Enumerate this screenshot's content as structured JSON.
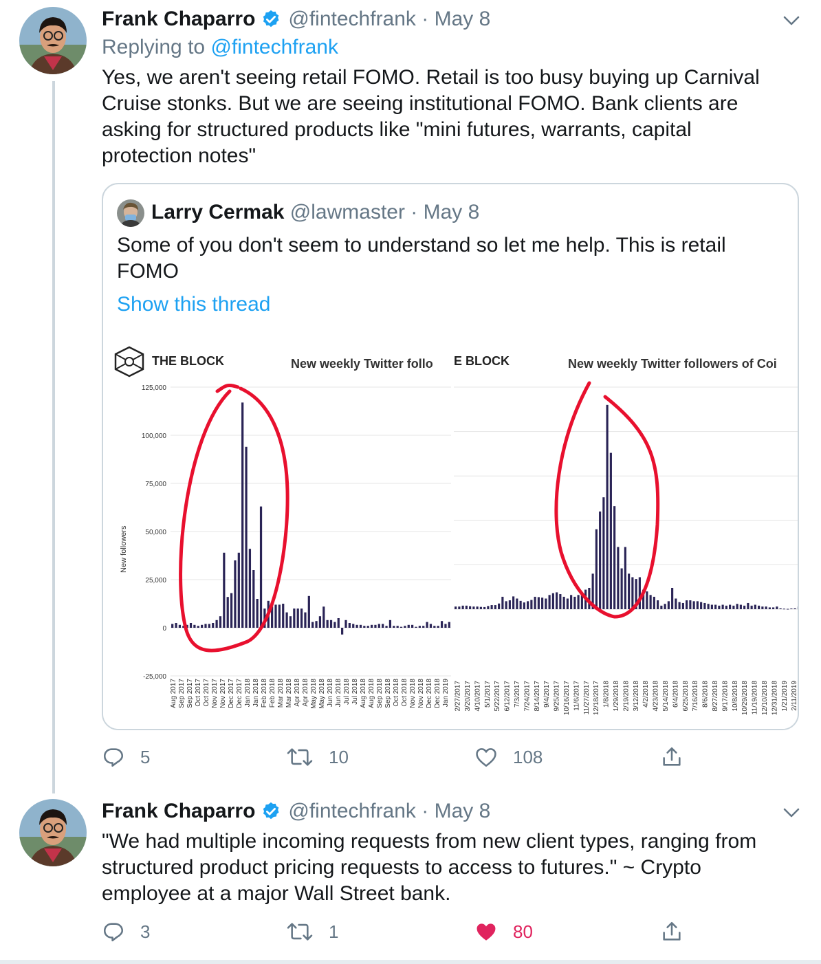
{
  "tweets": [
    {
      "author": {
        "name": "Frank Chaparro",
        "handle": "@fintechfrank",
        "verified": true
      },
      "date": "May 8",
      "replying_prefix": "Replying to ",
      "replying_to": "@fintechfrank",
      "text": "Yes, we aren't seeing retail FOMO. Retail is too busy buying up Carnival Cruise stonks. But we are seeing institutional FOMO. Bank clients are asking for structured products like \"mini futures, warrants, capital protection notes\"",
      "quote": {
        "author": {
          "name": "Larry Cermak",
          "handle": "@lawmaster"
        },
        "date": "May 8",
        "text": "Some of you don't seem to understand so let me help. This is retail FOMO",
        "show_thread": "Show this thread",
        "image": {
          "brand": "THE BLOCK",
          "brand_partial": "E BLOCK",
          "left_title": "New weekly Twitter follo",
          "right_title": "New weekly Twitter followers of Coi"
        }
      },
      "actions": {
        "replies": "5",
        "retweets": "10",
        "likes": "108",
        "liked": false
      }
    },
    {
      "author": {
        "name": "Frank Chaparro",
        "handle": "@fintechfrank",
        "verified": true
      },
      "date": "May 8",
      "text": "\"We had multiple incoming requests from new client types, ranging from structured product pricing requests to access to futures.\" ~ Crypto employee at a major Wall Street bank.",
      "actions": {
        "replies": "3",
        "retweets": "1",
        "likes": "80",
        "liked": true
      }
    }
  ],
  "separator": " · ",
  "icons": [
    "verified-badge-icon",
    "chevron-down-icon",
    "reply-icon",
    "retweet-icon",
    "like-icon",
    "share-icon",
    "the-block-logo-icon"
  ],
  "colors": {
    "accent": "#1da1f2",
    "text": "#14171a",
    "muted": "#657786",
    "like": "#e0245e",
    "bars": "#2a2456",
    "annotation": "#e8102e"
  },
  "chart_data": [
    {
      "type": "bar",
      "title": "New weekly Twitter follo",
      "ylabel": "New followers",
      "ylim": [
        -25000,
        125000
      ],
      "yticks": [
        "-25,000",
        "0",
        "25,000",
        "50,000",
        "75,000",
        "100,000",
        "125,000"
      ],
      "x_tick_labels": [
        "Aug 2017",
        "Sep 2017",
        "Sep 2017",
        "Oct 2017",
        "Oct 2017",
        "Nov 2017",
        "Nov 2017",
        "Dec 2017",
        "Dec 2017",
        "Jan 2018",
        "Jan 2018",
        "Feb 2018",
        "Feb 2018",
        "Mar 2018",
        "Mar 2018",
        "Apr 2018",
        "Apr 2018",
        "May 2018",
        "May 2018",
        "Jun 2018",
        "Jun 2018",
        "Jul 2018",
        "Jul 2018",
        "Aug 2018",
        "Aug 2018",
        "Sep 2018",
        "Sep 2018",
        "Oct 2018",
        "Oct 2018",
        "Nov 2018",
        "Nov 2018",
        "Dec 2018",
        "Dec 2018",
        "Jan 2019"
      ],
      "series": [
        {
          "values": [
            2000,
            2500,
            1500,
            1000,
            1500,
            2500,
            1500,
            1000,
            1500,
            2000,
            2000,
            2500,
            4000,
            6000,
            39000,
            16000,
            18000,
            35000,
            39000,
            117000,
            94000,
            41000,
            30000,
            15000,
            63000,
            10000,
            14000,
            11000,
            12000,
            12000,
            12500,
            8000,
            6000,
            10000,
            10000,
            10000,
            8000,
            16500,
            3000,
            3500,
            6000,
            11000,
            4000,
            4000,
            3000,
            5000,
            -3500,
            4000,
            2500,
            2000,
            1500,
            1500,
            1000,
            1000,
            1500,
            1500,
            2000,
            2000,
            1000,
            4000,
            1000,
            1000,
            500,
            1000,
            1500,
            1500,
            500,
            1000,
            1000,
            3000,
            2000,
            1000,
            1000,
            3500,
            2000,
            3000
          ]
        }
      ]
    },
    {
      "type": "bar",
      "title": "New weekly Twitter followers of Coi",
      "ylabel": "",
      "x_tick_labels": [
        "2/27/2017",
        "3/20/2017",
        "4/10/2017",
        "5/1/2017",
        "5/22/2017",
        "6/12/2017",
        "7/3/2017",
        "7/24/2017",
        "8/14/2017",
        "9/4/2017",
        "9/25/2017",
        "10/16/2017",
        "11/6/2017",
        "11/27/2017",
        "12/18/2017",
        "1/8/2018",
        "1/29/2018",
        "2/19/2018",
        "3/12/2018",
        "4/2/2018",
        "4/23/2018",
        "5/14/2018",
        "6/4/2018",
        "6/25/2018",
        "7/16/2018",
        "8/6/2018",
        "8/27/2018",
        "9/17/2018",
        "10/8/2018",
        "10/29/2018",
        "11/19/2018",
        "12/10/2018",
        "12/31/2018",
        "1/21/2019",
        "2/11/2019"
      ],
      "series": [
        {
          "values": [
            1500,
            1500,
            2000,
            2000,
            1700,
            1500,
            1500,
            1300,
            1200,
            1800,
            2300,
            2300,
            3200,
            7000,
            4500,
            5000,
            7200,
            6000,
            4700,
            3800,
            4500,
            5200,
            7000,
            6800,
            6500,
            6000,
            8000,
            9000,
            9500,
            8500,
            7000,
            6000,
            8000,
            7000,
            8000,
            9500,
            11000,
            12000,
            20000,
            45000,
            55000,
            63000,
            115000,
            88000,
            58000,
            35000,
            23000,
            35000,
            20000,
            18000,
            17000,
            18000,
            11000,
            10000,
            8000,
            7000,
            5000,
            2000,
            3000,
            4500,
            12000,
            6000,
            4000,
            3500,
            5000,
            5000,
            4500,
            4500,
            4000,
            3500,
            3000,
            2500,
            2500,
            2000,
            2500,
            2000,
            2500,
            2000,
            3000,
            2500,
            2000,
            3500,
            2000,
            2500,
            2000,
            1500,
            1500,
            1000,
            1000,
            1500,
            500,
            300,
            200,
            400,
            500,
            1500
          ]
        }
      ]
    }
  ]
}
